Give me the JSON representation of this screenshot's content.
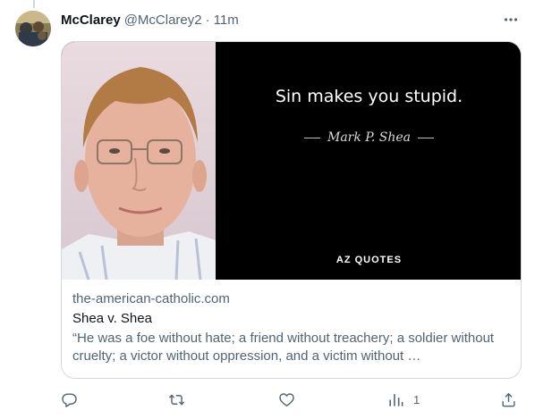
{
  "tweet": {
    "author_name": "McClarey",
    "author_handle": "@McClarey2",
    "separator": "·",
    "timestamp": "11m"
  },
  "card": {
    "image": {
      "quote": "Sin makes you stupid.",
      "author": "Mark P. Shea",
      "logo": "AZ QUOTES"
    },
    "domain": "the-american-catholic.com",
    "title": "Shea v. Shea",
    "description": "“He was a foe without hate; a friend without treachery; a soldier without cruelty; a victor without oppression, and a victim without …"
  },
  "actions": {
    "reply_icon": "reply-icon",
    "retweet_icon": "retweet-icon",
    "like_icon": "heart-icon",
    "views_icon": "views-icon",
    "views_count": "1",
    "share_icon": "share-icon"
  },
  "colors": {
    "text_primary": "#0f1419",
    "text_secondary": "#536471",
    "border": "#cfd9de"
  }
}
